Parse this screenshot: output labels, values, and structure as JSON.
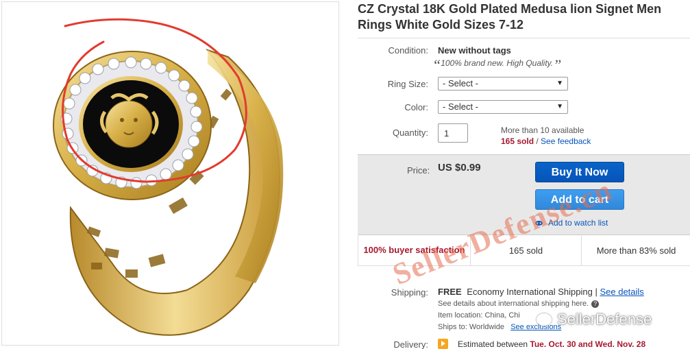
{
  "listing": {
    "title": "CZ Crystal 18K Gold Plated Medusa lion Signet Men Rings White Gold Sizes 7-12"
  },
  "condition": {
    "label": "Condition:",
    "value": "New without tags",
    "note": "100% brand new. High Quality."
  },
  "ring_size": {
    "label": "Ring Size:",
    "selected": "- Select -"
  },
  "color": {
    "label": "Color:",
    "selected": "- Select -"
  },
  "quantity": {
    "label": "Quantity:",
    "value": "1",
    "available": "More than 10 available",
    "sold_count": "165 sold",
    "separator": " / ",
    "feedback_link": "See feedback"
  },
  "price": {
    "label": "Price:",
    "value": "US $0.99"
  },
  "buttons": {
    "buy_now": "Buy It Now",
    "add_to_cart": "Add to cart",
    "watch": "Add to watch list"
  },
  "stats": {
    "satisfaction": "100% buyer satisfaction",
    "sold": "165 sold",
    "percent_sold": "More than 83% sold"
  },
  "shipping": {
    "label": "Shipping:",
    "free": "FREE",
    "method": "Economy International Shipping",
    "divider": " | ",
    "details_link": "See details",
    "international_note": "See details about international shipping here.",
    "item_location": "Item location:  China, Chi",
    "ships_to": "Ships to:  Worldwide",
    "exclusions_link": "See exclusions"
  },
  "delivery": {
    "label": "Delivery:",
    "text": "Estimated between",
    "dates": "Tue. Oct. 30 and Wed. Nov. 28"
  },
  "overlay": {
    "watermark": "SellerDefense.cn",
    "wechat": "SellerDefense"
  },
  "colors": {
    "link": "#0654ba",
    "sold_red": "#a6192e",
    "buy_button": "#0654ba",
    "cart_button": "#3088d9",
    "gold": "#d9b24a"
  }
}
